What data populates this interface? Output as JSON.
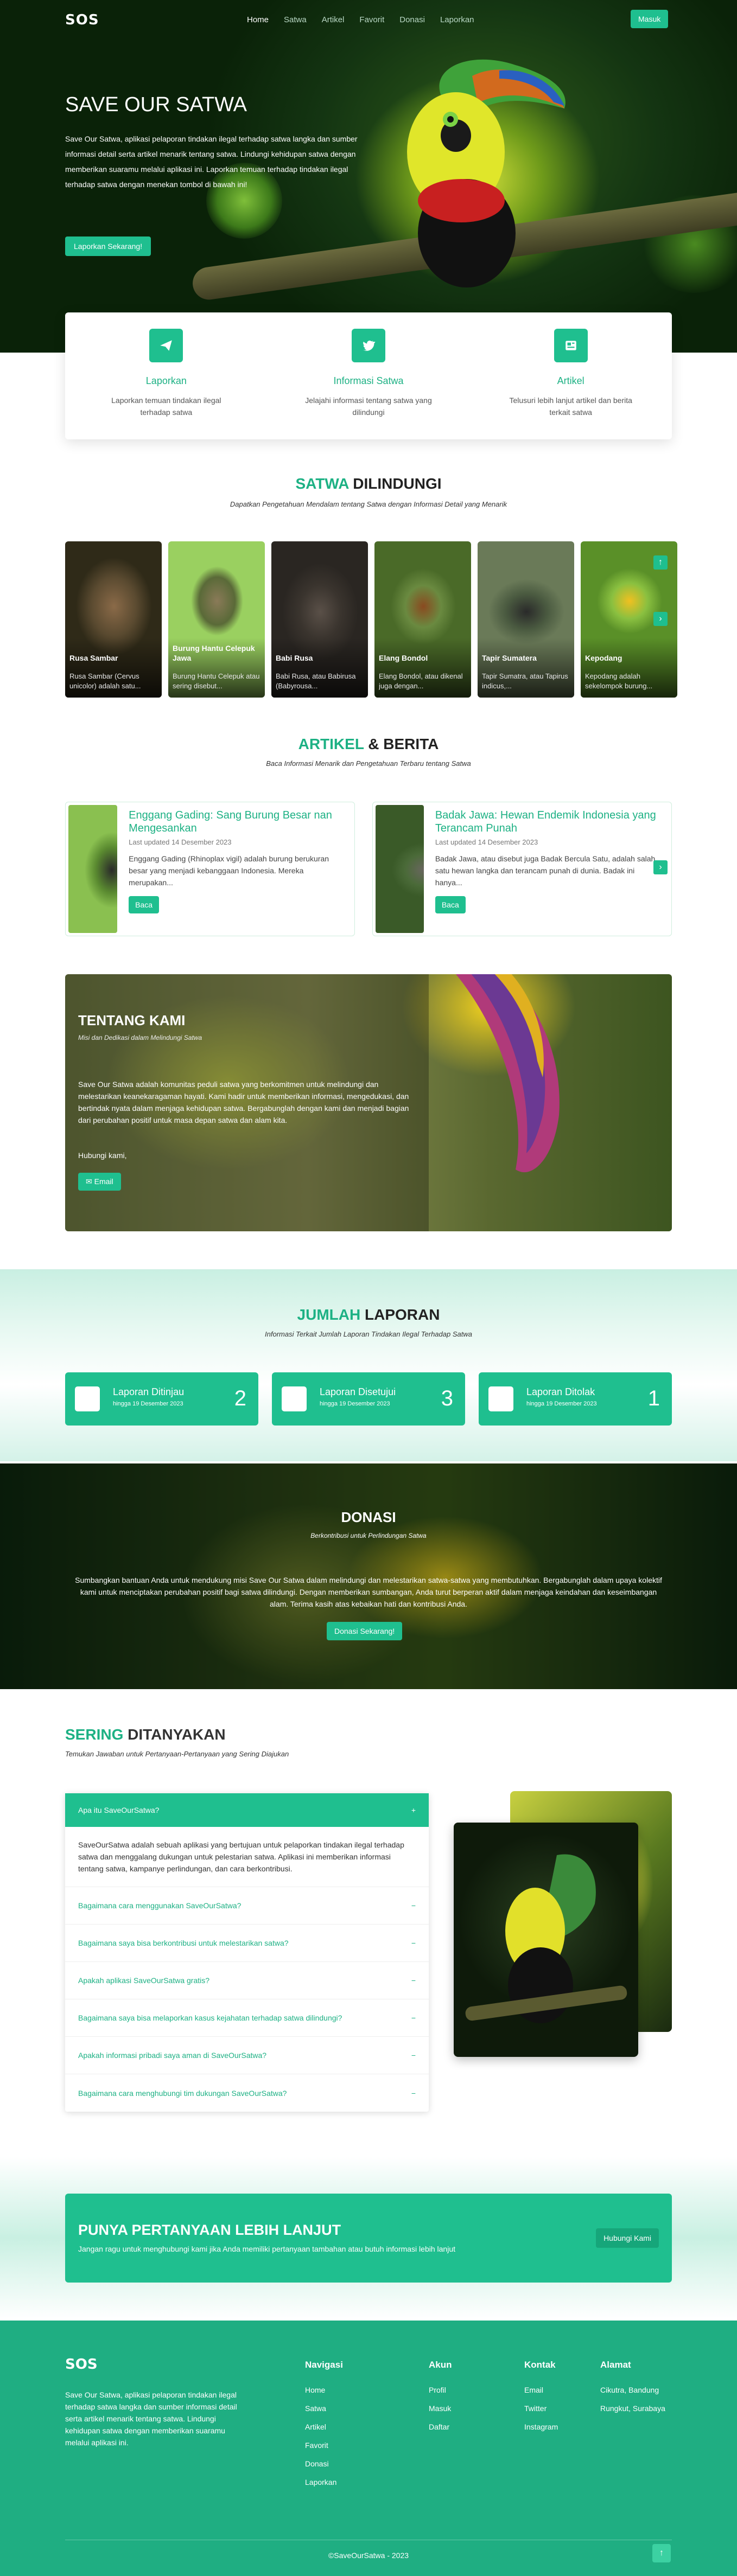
{
  "nav": {
    "logo": "SOS",
    "links": [
      "Home",
      "Satwa",
      "Artikel",
      "Favorit",
      "Donasi",
      "Laporkan"
    ],
    "login": "Masuk"
  },
  "hero": {
    "title": "SAVE OUR SATWA",
    "text": "Save Our Satwa, aplikasi pelaporan tindakan ilegal terhadap satwa langka dan sumber informasi detail serta artikel menarik tentang satwa. Lindungi kehidupan satwa dengan memberikan suaramu melalui aplikasi ini. Laporkan temuan terhadap tindakan ilegal terhadap satwa dengan menekan tombol di bawah ini!",
    "button": "Laporkan Sekarang!"
  },
  "features": [
    {
      "icon": "send-icon",
      "title": "Laporkan",
      "text": "Laporkan temuan tindakan ilegal terhadap satwa"
    },
    {
      "icon": "twitter-icon",
      "title": "Informasi Satwa",
      "text": "Jelajahi informasi tentang satwa yang dilindungi"
    },
    {
      "icon": "newspaper-icon",
      "title": "Artikel",
      "text": "Telusuri lebih lanjut artikel dan berita terkait satwa"
    }
  ],
  "satwa": {
    "title_a": "SATWA",
    "title_b": "DILINDUNGI",
    "subtitle": "Dapatkan Pengetahuan Mendalam tentang Satwa dengan Informasi Detail yang Menarik",
    "items": [
      {
        "name": "Rusa Sambar",
        "desc": "Rusa Sambar (Cervus unicolor) adalah satu..."
      },
      {
        "name": "Burung Hantu Celepuk Jawa",
        "desc": "Burung Hantu Celepuk atau sering disebut..."
      },
      {
        "name": "Babi Rusa",
        "desc": "Babi Rusa, atau Babirusa (Babyrousa..."
      },
      {
        "name": "Elang Bondol",
        "desc": "Elang Bondol, atau dikenal juga dengan..."
      },
      {
        "name": "Tapir Sumatera",
        "desc": "Tapir Sumatra, atau Tapirus indicus,..."
      },
      {
        "name": "Kepodang",
        "desc": "Kepodang adalah sekelompok burung..."
      }
    ]
  },
  "artikel": {
    "title_a": "ARTIKEL",
    "title_b": "& BERITA",
    "subtitle": "Baca Informasi Menarik dan Pengetahuan Terbaru tentang Satwa",
    "items": [
      {
        "title": "Enggang Gading: Sang Burung Besar nan Mengesankan",
        "date": "Last updated 14 Desember 2023",
        "text": "Enggang Gading (Rhinoplax vigil) adalah burung berukuran besar yang menjadi kebanggaan Indonesia. Mereka merupakan...",
        "button": "Baca"
      },
      {
        "title": "Badak Jawa: Hewan Endemik Indonesia yang Terancam Punah",
        "date": "Last updated 14 Desember 2023",
        "text": "Badak Jawa, atau disebut juga Badak Bercula Satu, adalah salah satu hewan langka dan terancam punah di dunia. Badak ini hanya...",
        "button": "Baca"
      }
    ]
  },
  "tentang": {
    "title": "TENTANG KAMI",
    "subtitle": "Misi dan Dedikasi dalam Melindungi Satwa",
    "text": "Save Our Satwa adalah komunitas peduli satwa yang berkomitmen untuk melindungi dan melestarikan keanekaragaman hayati. Kami hadir untuk memberikan informasi, mengedukasi, dan bertindak nyata dalam menjaga kehidupan satwa. Bergabunglah dengan kami dan menjadi bagian dari perubahan positif untuk masa depan satwa dan alam kita.",
    "salam": "Hubungi kami,",
    "button": "Email"
  },
  "jumlah": {
    "title_a": "JUMLAH",
    "title_b": "LAPORAN",
    "subtitle": "Informasi Terkait Jumlah Laporan Tindakan Ilegal Terhadap Satwa",
    "cards": [
      {
        "label": "Laporan Ditinjau",
        "date": "hingga 19 Desember 2023",
        "count": "2"
      },
      {
        "label": "Laporan Disetujui",
        "date": "hingga 19 Desember 2023",
        "count": "3"
      },
      {
        "label": "Laporan Ditolak",
        "date": "hingga 19 Desember 2023",
        "count": "1"
      }
    ]
  },
  "donasi": {
    "title": "DONASI",
    "subtitle": "Berkontribusi untuk Perlindungan Satwa",
    "text": "Sumbangkan bantuan Anda untuk mendukung misi Save Our Satwa dalam melindungi dan melestarikan satwa-satwa yang membutuhkan. Bergabunglah dalam upaya kolektif kami untuk menciptakan perubahan positif bagi satwa dilindungi. Dengan memberikan sumbangan, Anda turut berperan aktif dalam menjaga keindahan dan keseimbangan alam. Terima kasih atas kebaikan hati dan kontribusi Anda.",
    "button": "Donasi Sekarang!"
  },
  "faq": {
    "title_a": "SERING",
    "title_b": "DITANYAKAN",
    "subtitle": "Temukan Jawaban untuk Pertanyaan-Pertanyaan yang Sering Diajukan",
    "open_q": "Apa itu SaveOurSatwa?",
    "open_a": "SaveOurSatwa adalah sebuah aplikasi yang bertujuan untuk pelaporkan tindakan ilegal terhadap satwa dan menggalang dukungan untuk pelestarian satwa. Aplikasi ini memberikan informasi tentang satwa, kampanye perlindungan, dan cara berkontribusi.",
    "questions": [
      "Bagaimana cara menggunakan SaveOurSatwa?",
      "Bagaimana saya bisa berkontribusi untuk melestarikan satwa?",
      "Apakah aplikasi SaveOurSatwa gratis?",
      "Bagaimana saya bisa melaporkan kasus kejahatan terhadap satwa dilindungi?",
      "Apakah informasi pribadi saya aman di SaveOurSatwa?",
      "Bagaimana cara menghubungi tim dukungan SaveOurSatwa?"
    ]
  },
  "cta": {
    "title": "PUNYA PERTANYAAN LEBIH LANJUT",
    "text": "Jangan ragu untuk menghubungi kami jika Anda memiliki pertanyaan tambahan atau butuh informasi lebih lanjut",
    "button": "Hubungi Kami"
  },
  "footer": {
    "logo": "SOS",
    "desc": "Save Our Satwa, aplikasi pelaporan tindakan ilegal terhadap satwa langka dan sumber informasi detail serta artikel menarik tentang satwa. Lindungi kehidupan satwa dengan memberikan suaramu melalui aplikasi ini.",
    "cols": [
      {
        "title": "Navigasi",
        "items": [
          "Home",
          "Satwa",
          "Artikel",
          "Favorit",
          "Donasi",
          "Laporkan"
        ]
      },
      {
        "title": "Akun",
        "items": [
          "Profil",
          "Masuk",
          "Daftar"
        ]
      },
      {
        "title": "Kontak",
        "items": [
          "Email",
          "Twitter",
          "Instagram"
        ]
      },
      {
        "title": "Alamat",
        "items": [
          "Cikutra, Bandung",
          "Rungkut, Surabaya"
        ]
      }
    ],
    "copyright": "©SaveOurSatwa - 2023"
  }
}
